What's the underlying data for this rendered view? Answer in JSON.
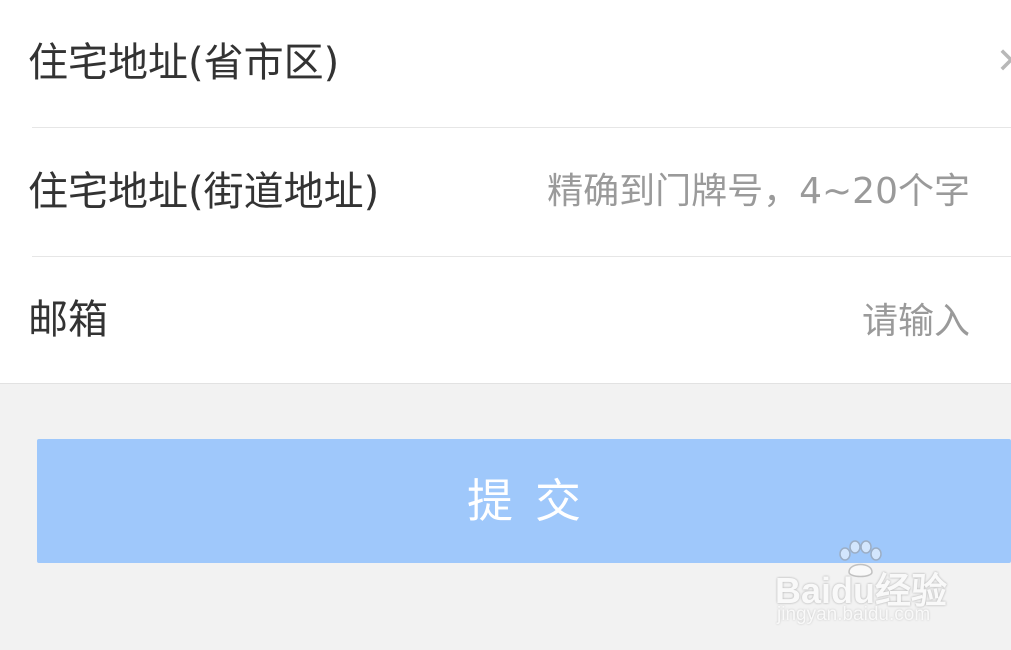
{
  "form": {
    "region": {
      "label": "住宅地址(省市区)",
      "value": ""
    },
    "street": {
      "label": "住宅地址(街道地址)",
      "placeholder": "精确到门牌号，4~20个字"
    },
    "email": {
      "label": "邮箱",
      "placeholder": "请输入"
    }
  },
  "icons": {
    "clear": "close-icon"
  },
  "submit": {
    "label": "提交"
  },
  "watermark": {
    "logo_text": "Baidu经验",
    "url_text": "jingyan.baidu.com"
  },
  "colors": {
    "background": "#f2f2f2",
    "form_background": "#ffffff",
    "label_text": "#333333",
    "placeholder_text": "#9a9a9a",
    "submit_background": "#9fc8fb",
    "submit_text": "#ffffff"
  }
}
